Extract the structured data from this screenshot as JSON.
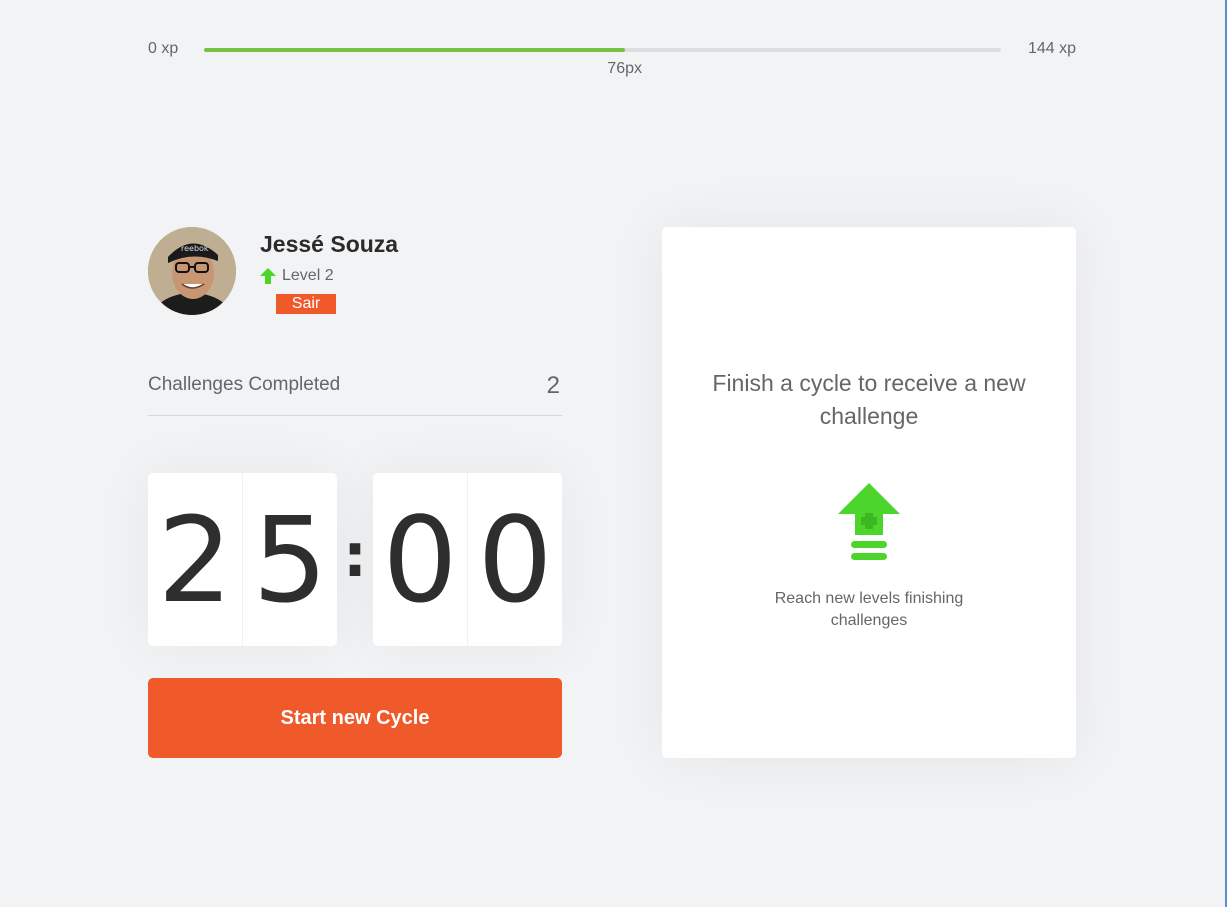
{
  "experience": {
    "min_label": "0 xp",
    "max_label": "144 xp",
    "current_label": "76px",
    "progress_fraction": 0.5278,
    "bar_color": "#7ac142"
  },
  "profile": {
    "name": "Jessé Souza",
    "level_label": "Level 2",
    "logout_label": "Sair",
    "level_icon": "level-up-arrow-icon",
    "accent_color": "#f05a2a",
    "level_icon_color": "#4cd62b"
  },
  "challenges": {
    "label": "Challenges Completed",
    "count": "2"
  },
  "countdown": {
    "minute_left": "2",
    "minute_right": "5",
    "separator": ":",
    "second_left": "0",
    "second_right": "0"
  },
  "start_button": {
    "label": "Start new Cycle"
  },
  "challenge_box": {
    "title": "Finish a cycle to receive a new challenge",
    "icon": "level-up-icon",
    "text": "Reach new levels finishing challenges"
  }
}
